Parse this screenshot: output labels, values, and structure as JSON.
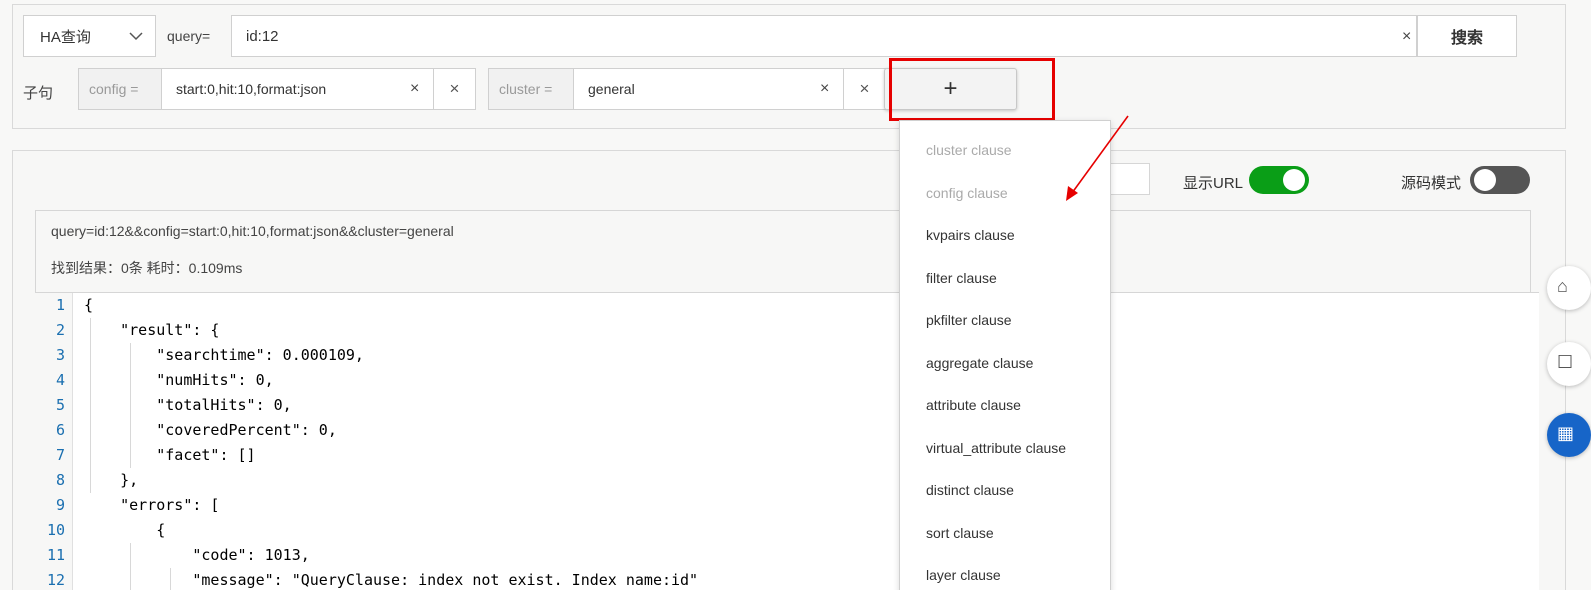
{
  "search": {
    "mode": "HA查询",
    "query_label": "query=",
    "query_value": "id:12",
    "clear_glyph": "×",
    "search_label": "搜索"
  },
  "clauses": {
    "label": "子句",
    "items": [
      {
        "key": "config =",
        "value": "start:0,hit:10,format:json"
      },
      {
        "key": "cluster =",
        "value": "general"
      }
    ],
    "add_label": "+",
    "delete_glyph": "×"
  },
  "toolbar": {
    "show_url_label": "显示URL",
    "show_url_on": true,
    "source_mode_label": "源码模式",
    "source_mode_on": false
  },
  "result": {
    "url": "query=id:12&&config=start:0,hit:10,format:json&&cluster=general",
    "stats": "找到结果：0条  耗时：0.109ms"
  },
  "code_lines": [
    "{",
    "    \"result\": {",
    "        \"searchtime\": 0.000109,",
    "        \"numHits\": 0,",
    "        \"totalHits\": 0,",
    "        \"coveredPercent\": 0,",
    "        \"facet\": []",
    "    },",
    "    \"errors\": [",
    "        {",
    "            \"code\": 1013,",
    "            \"message\": \"QueryClause: index not exist. Index name:id\""
  ],
  "dropdown": [
    {
      "label": "cluster clause",
      "disabled": true
    },
    {
      "label": "config clause",
      "disabled": true
    },
    {
      "label": "kvpairs clause",
      "disabled": false
    },
    {
      "label": "filter clause",
      "disabled": false
    },
    {
      "label": "pkfilter clause",
      "disabled": false
    },
    {
      "label": "aggregate clause",
      "disabled": false
    },
    {
      "label": "attribute clause",
      "disabled": false
    },
    {
      "label": "virtual_attribute clause",
      "disabled": false
    },
    {
      "label": "distinct clause",
      "disabled": false
    },
    {
      "label": "sort clause",
      "disabled": false
    },
    {
      "label": "layer clause",
      "disabled": false
    }
  ],
  "colors": {
    "highlight": "#e60000",
    "toggle_on": "#0a9e17",
    "toggle_off": "#555555",
    "line_number": "#1a6fb0",
    "side_blue": "#1765c8"
  },
  "side_icons": [
    "bell-icon",
    "message-icon",
    "grid-icon"
  ]
}
